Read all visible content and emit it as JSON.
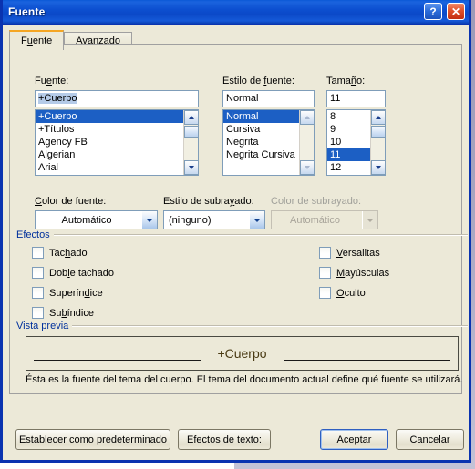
{
  "window": {
    "title": "Fuente",
    "help_icon": "?",
    "close_icon": "✕"
  },
  "tabs": [
    {
      "label": "Fuente",
      "mnemonic": "u",
      "active": true
    },
    {
      "label": "Avanzado",
      "mnemonic": "A",
      "active": false
    }
  ],
  "font_section": {
    "font_label": "Fuente:",
    "font_label_mnemonic": "e",
    "font_value": "+Cuerpo",
    "font_items": [
      "+Cuerpo",
      "+Títulos",
      "Agency FB",
      "Algerian",
      "Arial"
    ],
    "font_selected": "+Cuerpo",
    "style_label": "Estilo de fuente:",
    "style_label_mnemonic": "f",
    "style_value": "Normal",
    "style_items": [
      "Normal",
      "Cursiva",
      "Negrita",
      "Negrita Cursiva"
    ],
    "style_selected": "Normal",
    "size_label": "Tamaño:",
    "size_label_mnemonic": "ñ",
    "size_value": "11",
    "size_items": [
      "8",
      "9",
      "10",
      "11",
      "12"
    ],
    "size_selected": "11"
  },
  "color_section": {
    "font_color_label": "Color de fuente:",
    "font_color_value": "Automático",
    "underline_style_label": "Estilo de subrayado:",
    "underline_style_value": "(ninguno)",
    "underline_color_label": "Color de subrayado:",
    "underline_color_value": "Automático",
    "underline_color_disabled": true
  },
  "effects": {
    "group_label": "Efectos",
    "left_items": [
      {
        "label": "Tachado",
        "checked": false
      },
      {
        "label": "Doble tachado",
        "checked": false
      },
      {
        "label": "Superíndice",
        "checked": false
      },
      {
        "label": "Subíndice",
        "checked": false
      }
    ],
    "right_items": [
      {
        "label": "Versalitas",
        "checked": false
      },
      {
        "label": "Mayúsculas",
        "checked": false
      },
      {
        "label": "Oculto",
        "checked": false
      }
    ]
  },
  "preview": {
    "group_label": "Vista previa",
    "sample_text": "+Cuerpo",
    "description": "Ésta es la fuente del tema del cuerpo. El tema del documento actual define qué fuente se utilizará."
  },
  "buttons": {
    "set_default": "Establecer como predeterminado",
    "text_effects": "Efectos de texto:",
    "ok": "Aceptar",
    "cancel": "Cancelar"
  },
  "colors": {
    "titlebar_blue": "#0b4fd0",
    "dialog_border": "#0a33b0",
    "face": "#ece9d8",
    "selection_blue": "#1c5fc4",
    "group_label_blue": "#00309c",
    "active_tab_accent": "#f5a623"
  }
}
